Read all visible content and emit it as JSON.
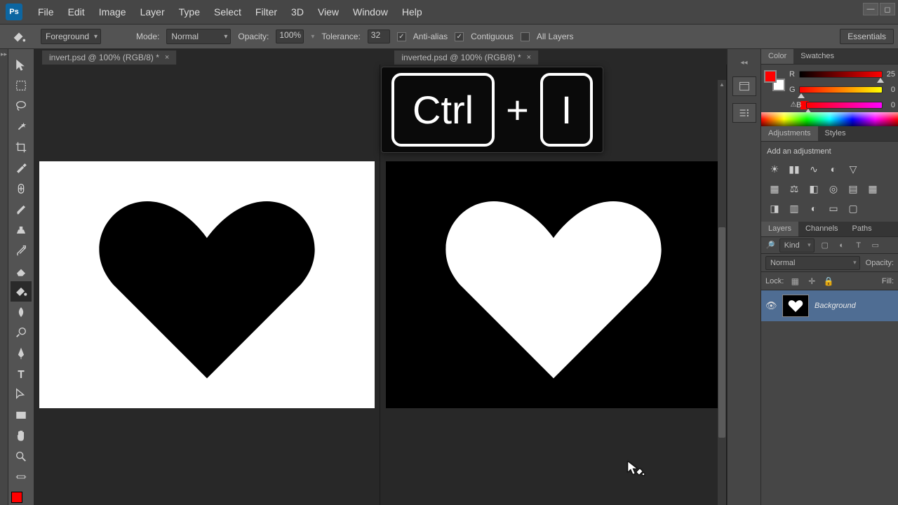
{
  "app": "Ps",
  "menu": [
    "File",
    "Edit",
    "Image",
    "Layer",
    "Type",
    "Select",
    "Filter",
    "3D",
    "View",
    "Window",
    "Help"
  ],
  "options": {
    "fill_mode": "Foreground",
    "mode_label": "Mode:",
    "mode_value": "Normal",
    "opacity_label": "Opacity:",
    "opacity_value": "100%",
    "tolerance_label": "Tolerance:",
    "tolerance_value": "32",
    "antialias_label": "Anti-alias",
    "contiguous_label": "Contiguous",
    "alllayers_label": "All Layers",
    "essentials": "Essentials"
  },
  "tabs": [
    {
      "label": "invert.psd @ 100% (RGB/8) *"
    },
    {
      "label": "inverted.psd @ 100% (RGB/8) *"
    }
  ],
  "shortcut": {
    "k1": "Ctrl",
    "plus": "+",
    "k2": "I"
  },
  "color_panel": {
    "tabs": [
      "Color",
      "Swatches"
    ],
    "R_label": "R",
    "R_value": "25",
    "G_label": "G",
    "G_value": "0",
    "B_label": "B",
    "B_value": "0",
    "fg": "#ff0000",
    "bg": "#ffffff"
  },
  "adjustments_panel": {
    "tabs": [
      "Adjustments",
      "Styles"
    ],
    "label": "Add an adjustment"
  },
  "layers_panel": {
    "tabs": [
      "Layers",
      "Channels",
      "Paths"
    ],
    "kind": "Kind",
    "blend": "Normal",
    "opacity_label": "Opacity:",
    "lock_label": "Lock:",
    "fill_label": "Fill:",
    "layer_name": "Background"
  }
}
